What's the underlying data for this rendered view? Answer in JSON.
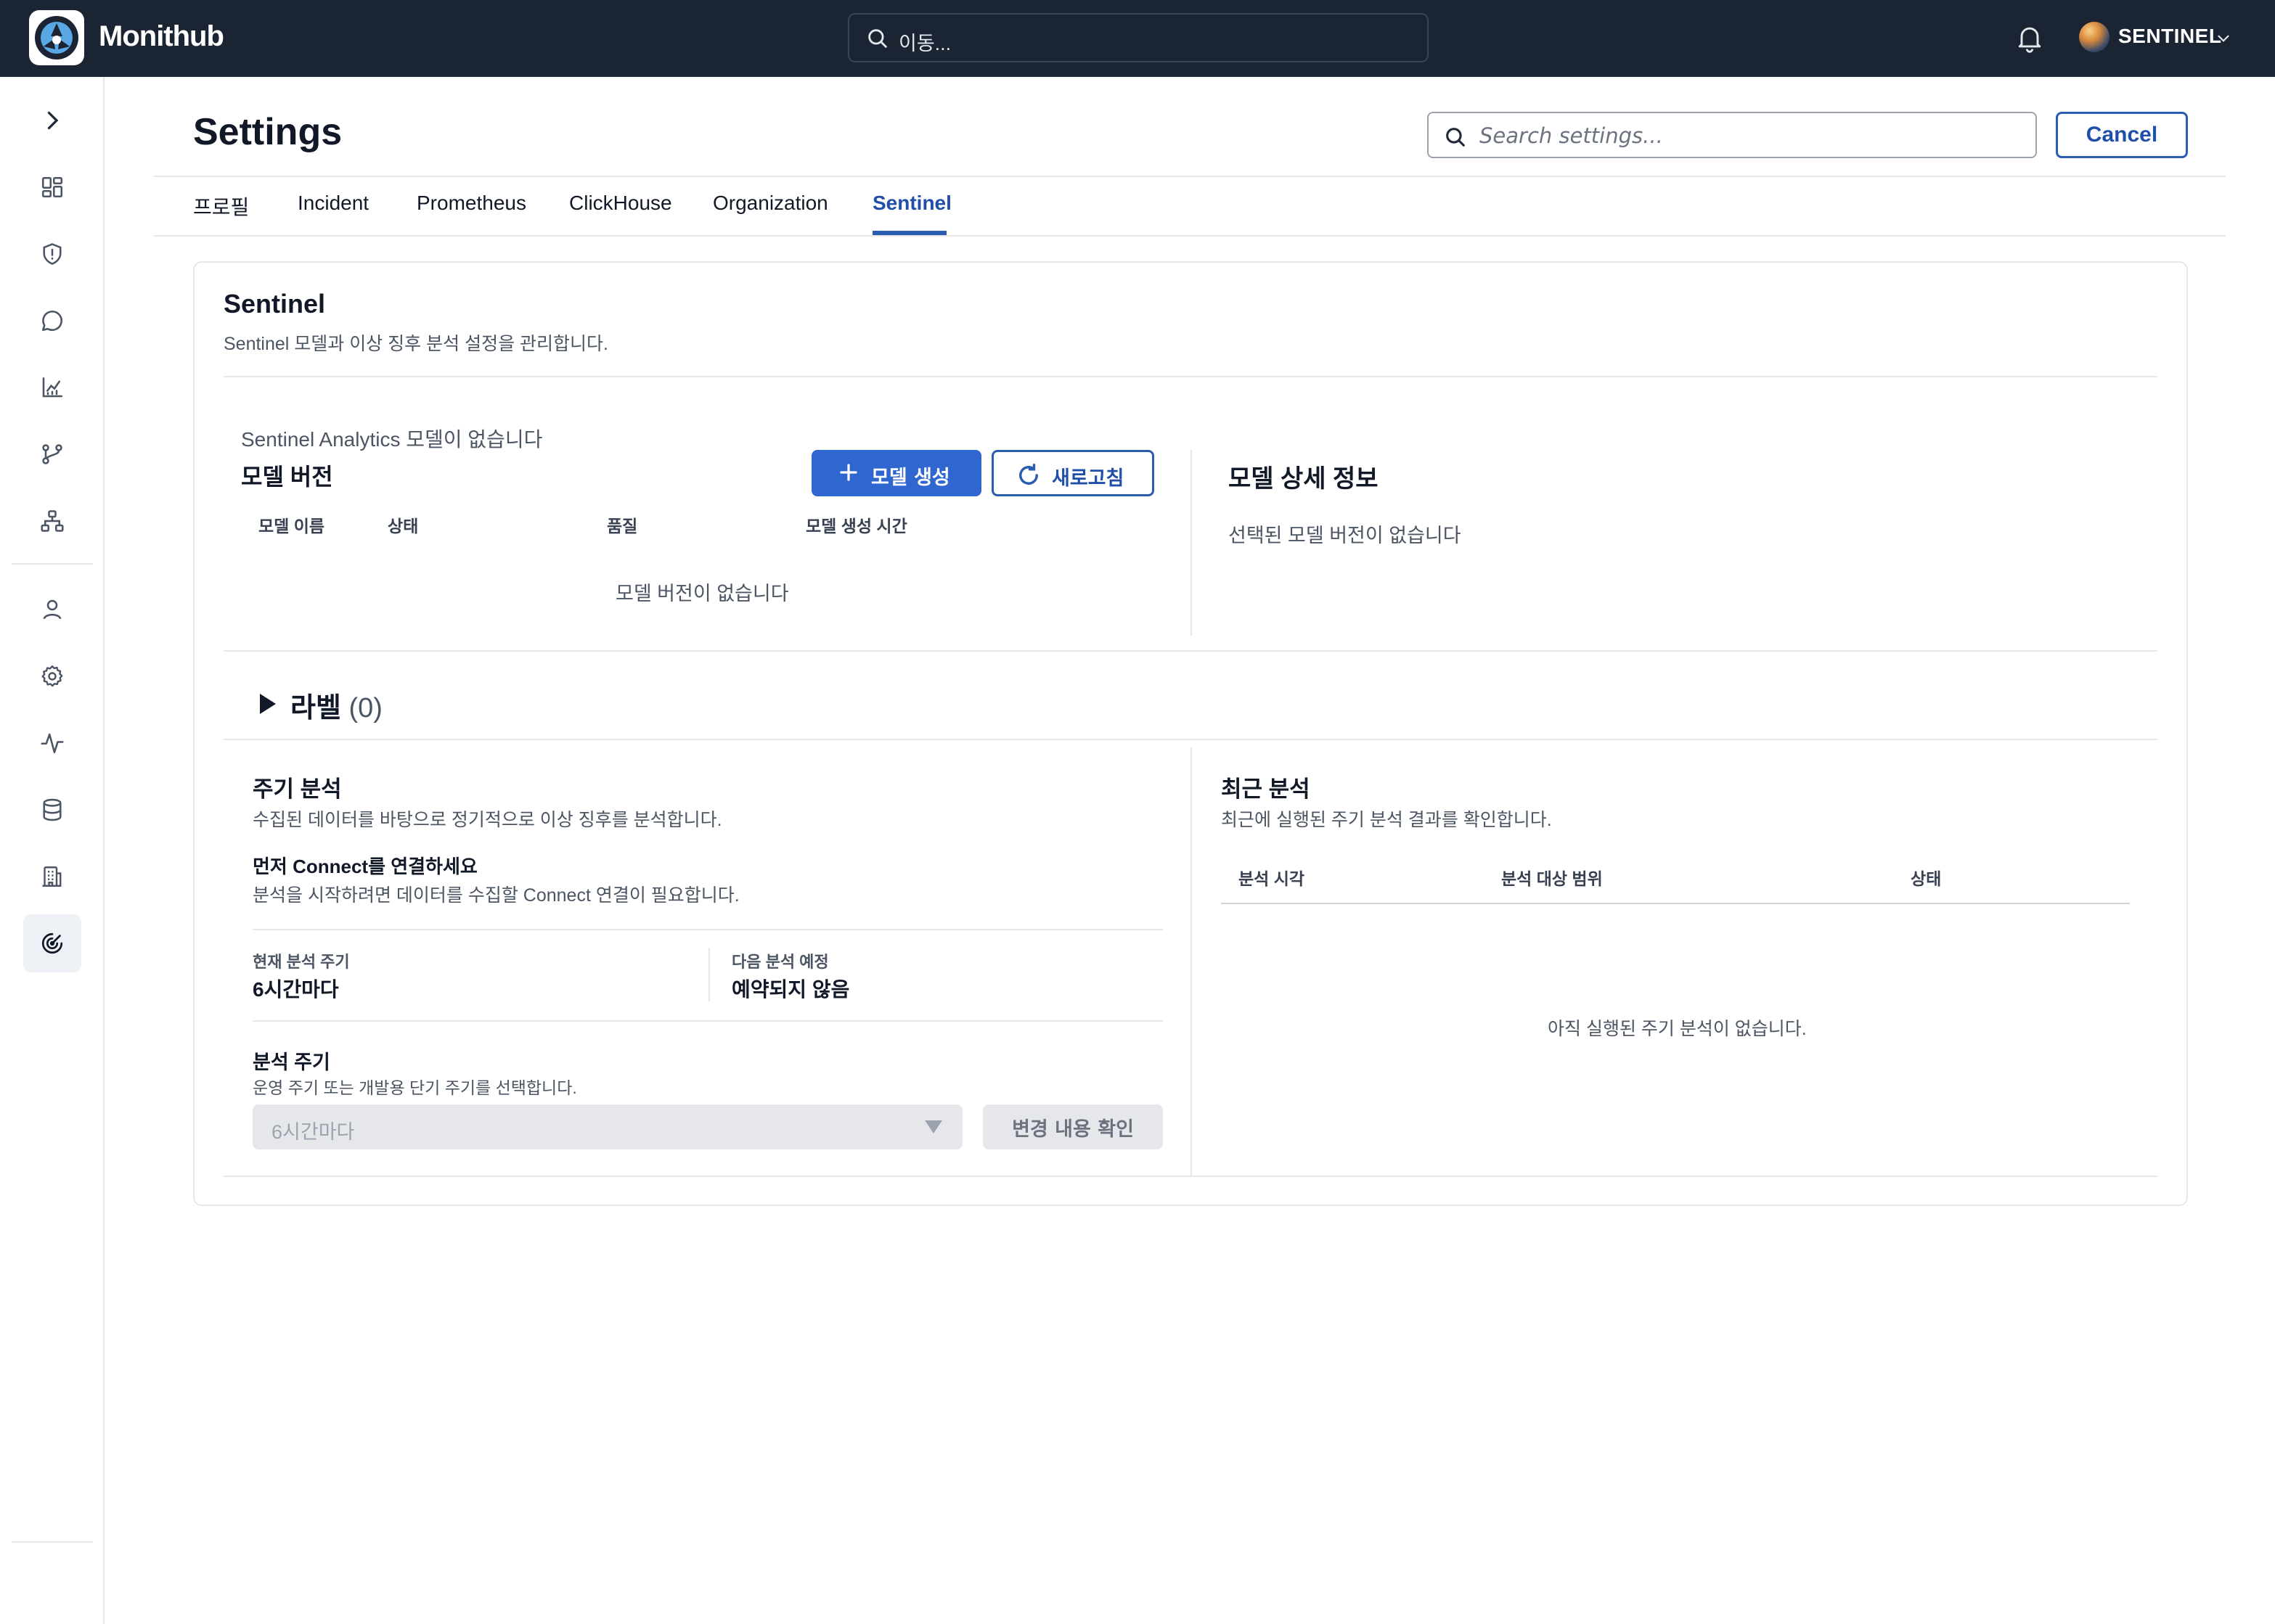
{
  "app": {
    "brand": "Monithub",
    "global_search_placeholder": "이동...",
    "user_name": "SENTINEL"
  },
  "header": {
    "title": "Settings",
    "search_placeholder": "Search settings...",
    "cancel_label": "Cancel"
  },
  "tabs": [
    {
      "label": "프로필",
      "active": false
    },
    {
      "label": "Incident",
      "active": false
    },
    {
      "label": "Prometheus",
      "active": false
    },
    {
      "label": "ClickHouse",
      "active": false
    },
    {
      "label": "Organization",
      "active": false
    },
    {
      "label": "Sentinel",
      "active": true
    }
  ],
  "sentinel": {
    "title": "Sentinel",
    "description": "Sentinel 모델과 이상 징후 분석 설정을 관리합니다."
  },
  "models": {
    "notice": "Sentinel Analytics 모델이 없습니다",
    "title": "모델 버전",
    "create_label": "모델 생성",
    "refresh_label": "새로고침",
    "columns": [
      "모델 이름",
      "상태",
      "품질",
      "모델 생성 시간"
    ],
    "empty": "모델 버전이 없습니다",
    "detail_title": "모델 상세 정보",
    "detail_empty": "선택된 모델 버전이 없습니다"
  },
  "labels": {
    "title": "라벨",
    "count": "(0)"
  },
  "periodic": {
    "title": "주기 분석",
    "description": "수집된 데이터를 바탕으로 정기적으로 이상 징후를 분석합니다.",
    "connect_title": "먼저 Connect를 연결하세요",
    "connect_desc": "분석을 시작하려면 데이터를 수집할 Connect 연결이 필요합니다.",
    "current_label": "현재 분석 주기",
    "current_value": "6시간마다",
    "next_label": "다음 분석 예정",
    "next_value": "예약되지 않음",
    "interval_title": "분석 주기",
    "interval_desc": "운영 주기 또는 개발용 단기 주기를 선택합니다.",
    "interval_selected": "6시간마다",
    "confirm_label": "변경 내용 확인"
  },
  "recent": {
    "title": "최근 분석",
    "description": "최근에 실행된 주기 분석 결과를 확인합니다.",
    "columns": [
      "분석 시각",
      "분석 대상 범위",
      "상태"
    ],
    "empty": "아직 실행된 주기 분석이 없습니다."
  },
  "colors": {
    "topbar": "#1b2433",
    "accent": "#2f66d0",
    "accent_dark": "#1f4fa8"
  },
  "icons": {
    "sidebar": [
      "chevron-right-icon",
      "dashboard-icon",
      "shield-alert-icon",
      "chat-icon",
      "chart-icon",
      "git-branch-icon",
      "network-icon",
      "user-icon",
      "gear-icon",
      "activity-icon",
      "database-icon",
      "building-icon",
      "radar-icon"
    ]
  }
}
